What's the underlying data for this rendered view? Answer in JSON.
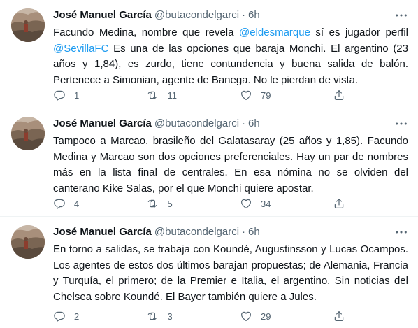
{
  "tweets": [
    {
      "name": "José Manuel García",
      "handle": "@butacondelgarci",
      "separator": "·",
      "time": "6h",
      "text_parts": [
        {
          "t": "Facundo Medina, nombre que revela ",
          "m": false
        },
        {
          "t": "@eldesmarque",
          "m": true
        },
        {
          "t": " sí es jugador perfil ",
          "m": false
        },
        {
          "t": "@SevillaFC",
          "m": true
        },
        {
          "t": " Es una de las opciones que baraja Monchi. El argentino (23 años y 1,84), es zurdo, tiene contundencia y buena salida de balón. Pertenece a Simonian, agente de Banega. No le pierdan de vista.",
          "m": false
        }
      ],
      "replies": "1",
      "retweets": "11",
      "likes": "79"
    },
    {
      "name": "José Manuel García",
      "handle": "@butacondelgarci",
      "separator": "·",
      "time": "6h",
      "text_parts": [
        {
          "t": "Tampoco a Marcao, brasileño del Galatasaray (25 años y 1,85). Facundo Medina y Marcao son dos opciones preferenciales. Hay un par de nombres más en la lista final de centrales. En esa nómina no se olviden del canterano Kike Salas, por el que Monchi quiere apostar.",
          "m": false
        }
      ],
      "replies": "4",
      "retweets": "5",
      "likes": "34"
    },
    {
      "name": "José Manuel García",
      "handle": "@butacondelgarci",
      "separator": "·",
      "time": "6h",
      "text_parts": [
        {
          "t": "En torno a salidas, se trabaja con Koundé, Augustinsson y Lucas Ocampos. Los agentes de estos dos últimos barajan propuestas; de Alemania, Francia y Turquía, el primero; de la Premier e Italia, el argentino. Sin noticias del Chelsea sobre Koundé. El Bayer también quiere a Jules.",
          "m": false
        }
      ],
      "replies": "2",
      "retweets": "3",
      "likes": "29"
    }
  ],
  "colors": {
    "text": "#0f1419",
    "muted": "#536471",
    "link": "#1d9bf0",
    "divider": "#eff3f4"
  },
  "icons": {
    "more": "more-horizontal-icon",
    "reply": "reply-bubble-icon",
    "retweet": "retweet-icon",
    "like": "heart-icon",
    "share": "share-icon"
  }
}
